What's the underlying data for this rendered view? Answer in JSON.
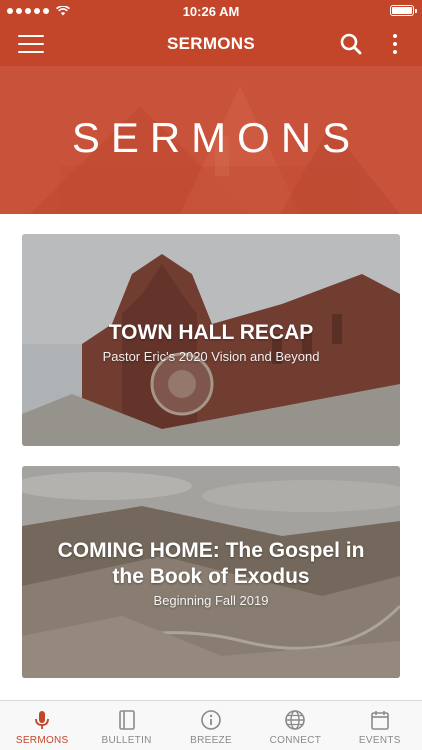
{
  "status_bar": {
    "time": "10:26 AM"
  },
  "app_bar": {
    "title": "SERMONS"
  },
  "hero": {
    "title": "SERMONS"
  },
  "cards": [
    {
      "title": "TOWN HALL RECAP",
      "subtitle": "Pastor Eric's 2020 Vision and Beyond"
    },
    {
      "title": "COMING HOME: The Gospel in the Book of Exodus",
      "subtitle": "Beginning Fall 2019"
    }
  ],
  "tabs": [
    {
      "label": "SERMONS",
      "icon": "microphone-icon",
      "active": true
    },
    {
      "label": "BULLETIN",
      "icon": "book-icon",
      "active": false
    },
    {
      "label": "BREEZE",
      "icon": "info-icon",
      "active": false
    },
    {
      "label": "CONNECT",
      "icon": "globe-icon",
      "active": false
    },
    {
      "label": "EVENTS",
      "icon": "calendar-icon",
      "active": false
    }
  ],
  "colors": {
    "accent": "#c4462a",
    "tab_inactive": "#8a8a8a"
  }
}
